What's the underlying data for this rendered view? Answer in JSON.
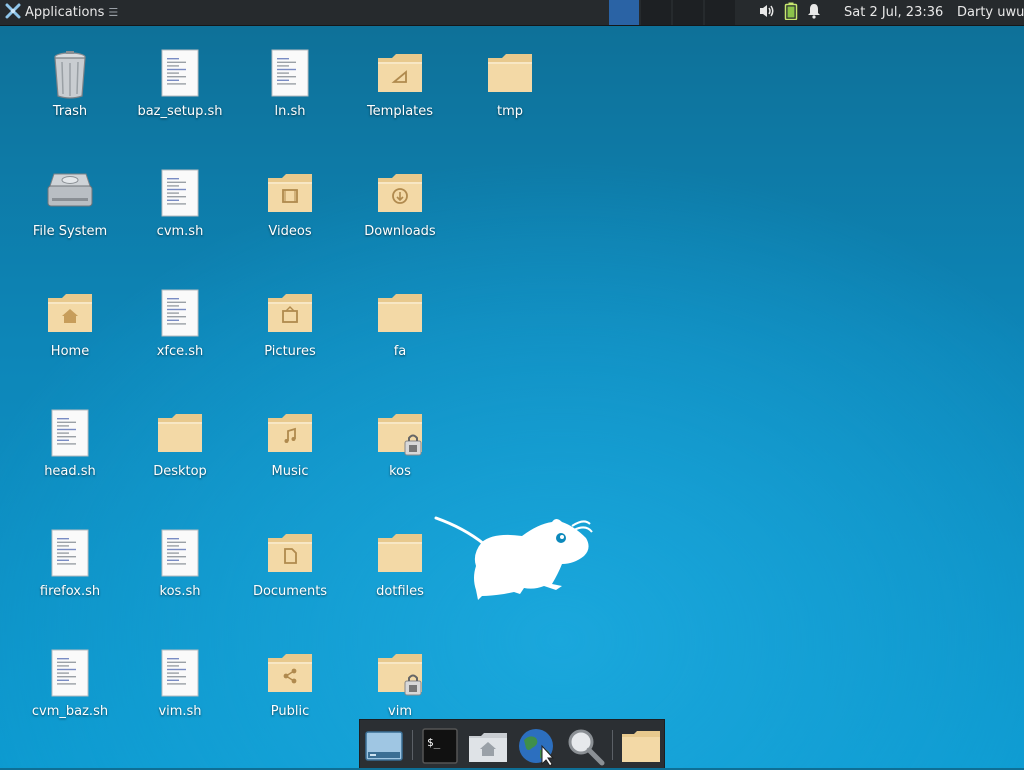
{
  "panel": {
    "apps_label": "Applications",
    "apps_icon": "xfce-logo-icon",
    "clock": "Sat  2 Jul, 23:36",
    "user": "Darty uwu",
    "tray_icons": [
      "volume-icon",
      "battery-icon",
      "notification-bell-icon"
    ]
  },
  "desktop": {
    "icons": [
      {
        "label": "Trash",
        "type": "trash"
      },
      {
        "label": "baz_setup.sh",
        "type": "script"
      },
      {
        "label": "ln.sh",
        "type": "script"
      },
      {
        "label": "Templates",
        "type": "folder-templates"
      },
      {
        "label": "tmp",
        "type": "folder"
      },
      {
        "label": "File System",
        "type": "drive"
      },
      {
        "label": "cvm.sh",
        "type": "script"
      },
      {
        "label": "Videos",
        "type": "folder-videos"
      },
      {
        "label": "Downloads",
        "type": "folder-downloads"
      },
      {
        "label": "Home",
        "type": "folder-home"
      },
      {
        "label": "xfce.sh",
        "type": "script"
      },
      {
        "label": "Pictures",
        "type": "folder-pictures"
      },
      {
        "label": "fa",
        "type": "folder"
      },
      {
        "label": "head.sh",
        "type": "script"
      },
      {
        "label": "Desktop",
        "type": "folder"
      },
      {
        "label": "Music",
        "type": "folder-music"
      },
      {
        "label": "kos",
        "type": "folder-locked"
      },
      {
        "label": "firefox.sh",
        "type": "script"
      },
      {
        "label": "kos.sh",
        "type": "script"
      },
      {
        "label": "Documents",
        "type": "folder-documents"
      },
      {
        "label": "dotfiles",
        "type": "folder"
      },
      {
        "label": "cvm_baz.sh",
        "type": "script"
      },
      {
        "label": "vim.sh",
        "type": "script"
      },
      {
        "label": "Public",
        "type": "folder-public"
      },
      {
        "label": "vim",
        "type": "folder-locked"
      }
    ]
  },
  "dock": {
    "items": [
      "show-desktop-icon",
      "terminal-icon",
      "home-folder-icon",
      "web-browser-icon",
      "app-finder-icon",
      "folder-icon"
    ]
  },
  "colors": {
    "panel": "#262a2d",
    "active_workspace": "#2a63a5",
    "folder": "#f3d9a6",
    "desktop_top": "#0e6f96",
    "desktop_bottom": "#0c9ad0"
  }
}
